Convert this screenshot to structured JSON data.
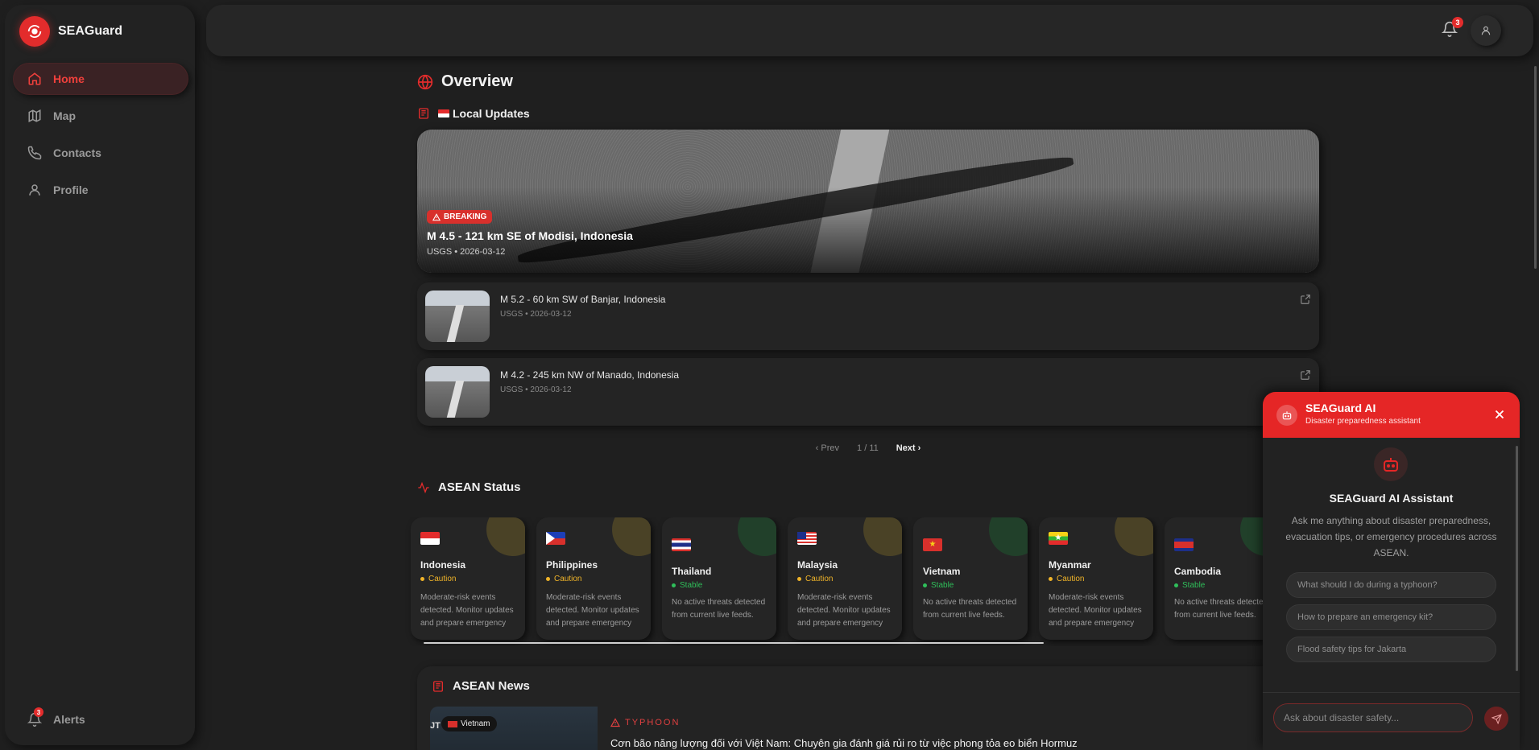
{
  "brand": {
    "name": "SEAGuard"
  },
  "nav": [
    {
      "label": "Home",
      "icon": "home-icon",
      "active": true
    },
    {
      "label": "Map",
      "icon": "map-icon"
    },
    {
      "label": "Contacts",
      "icon": "phone-icon"
    },
    {
      "label": "Profile",
      "icon": "user-icon"
    }
  ],
  "alerts": {
    "label": "Alerts",
    "count": "3"
  },
  "topbar": {
    "notifications": "3"
  },
  "overview": {
    "title": "Overview"
  },
  "local": {
    "title": "Local Updates",
    "hero": {
      "badge": "BREAKING",
      "title": "M 4.5 - 121 km SE of Modisi, Indonesia",
      "meta": "USGS • 2026-03-12"
    },
    "items": [
      {
        "title": "M 5.2 - 60 km SW of Banjar, Indonesia",
        "meta": "USGS • 2026-03-12"
      },
      {
        "title": "M 4.2 - 245 km NW of Manado, Indonesia",
        "meta": "USGS • 2026-03-12"
      }
    ],
    "pager": {
      "prev": "Prev",
      "page": "1 / 11",
      "next": "Next"
    }
  },
  "status": {
    "title": "ASEAN Status",
    "countries": [
      {
        "name": "Indonesia",
        "status": "Caution",
        "desc": "Moderate-risk events detected. Monitor updates and prepare emergency supplies."
      },
      {
        "name": "Philippines",
        "status": "Caution",
        "desc": "Moderate-risk events detected. Monitor updates and prepare emergency supplies."
      },
      {
        "name": "Thailand",
        "status": "Stable",
        "desc": "No active threats detected from current live feeds."
      },
      {
        "name": "Malaysia",
        "status": "Caution",
        "desc": "Moderate-risk events detected. Monitor updates and prepare emergency supplies."
      },
      {
        "name": "Vietnam",
        "status": "Stable",
        "desc": "No active threats detected from current live feeds."
      },
      {
        "name": "Myanmar",
        "status": "Caution",
        "desc": "Moderate-risk events detected. Monitor updates and prepare emergency supplies."
      },
      {
        "name": "Cambodia",
        "status": "Stable",
        "desc": "No active threats detected from current live feeds."
      }
    ]
  },
  "asean_news": {
    "title": "ASEAN News",
    "item": {
      "country": "Vietnam",
      "thumb_text": "JT",
      "category": "TYPHOON",
      "title": "Cơn bão năng lượng đối với Việt Nam: Chuyên gia đánh giá rủi ro từ việc phong tỏa eo biển Hormuz"
    }
  },
  "chat": {
    "title": "SEAGuard AI",
    "subtitle": "Disaster preparedness assistant",
    "assistant_title": "SEAGuard AI Assistant",
    "assistant_desc": "Ask me anything about disaster preparedness, evacuation tips, or emergency procedures across ASEAN.",
    "suggestions": [
      "What should I do during a typhoon?",
      "How to prepare an emergency kit?",
      "Flood safety tips for Jakarta"
    ],
    "input_placeholder": "Ask about disaster safety..."
  },
  "colors": {
    "accent": "#e52626",
    "caution": "#f0b429",
    "stable": "#2fbf5a"
  }
}
